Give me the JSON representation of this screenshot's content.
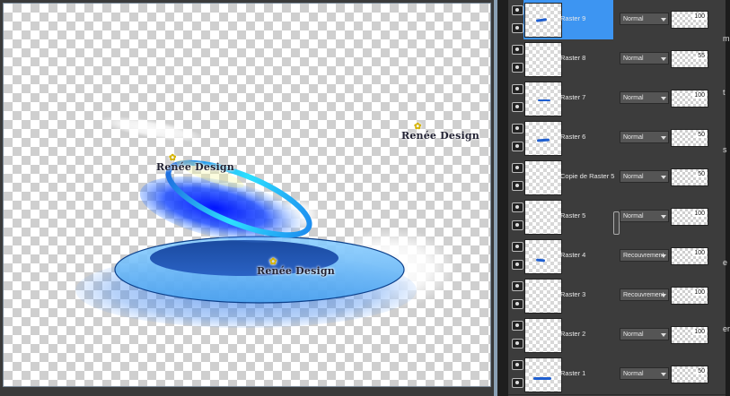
{
  "canvas": {
    "watermarks": [
      "Renée Design",
      "Renée Design",
      "Renée Design"
    ]
  },
  "layers": [
    {
      "name": "Raster 9",
      "blend": "Normal",
      "opacity": "100",
      "selected": true
    },
    {
      "name": "Raster 8",
      "blend": "Normal",
      "opacity": "55",
      "selected": false
    },
    {
      "name": "Raster 7",
      "blend": "Normal",
      "opacity": "100",
      "selected": false
    },
    {
      "name": "Raster 6",
      "blend": "Normal",
      "opacity": "50",
      "selected": false
    },
    {
      "name": "Copie de Raster 5",
      "blend": "Normal",
      "opacity": "50",
      "selected": false
    },
    {
      "name": "Raster 5",
      "blend": "Normal",
      "opacity": "100",
      "selected": false
    },
    {
      "name": "Raster 4",
      "blend": "Recouvrement",
      "opacity": "100",
      "selected": false
    },
    {
      "name": "Raster 3",
      "blend": "Recouvrement",
      "opacity": "100",
      "selected": false
    },
    {
      "name": "Raster 2",
      "blend": "Normal",
      "opacity": "100",
      "selected": false
    },
    {
      "name": "Raster 1",
      "blend": "Normal",
      "opacity": "50",
      "selected": false
    }
  ],
  "truncated_text": [
    "m",
    "t",
    "s",
    "e",
    "er"
  ],
  "colors": {
    "selected": "#3d95f2",
    "panel": "#3c3c3c",
    "accent_blue": "#1f5fd0"
  }
}
